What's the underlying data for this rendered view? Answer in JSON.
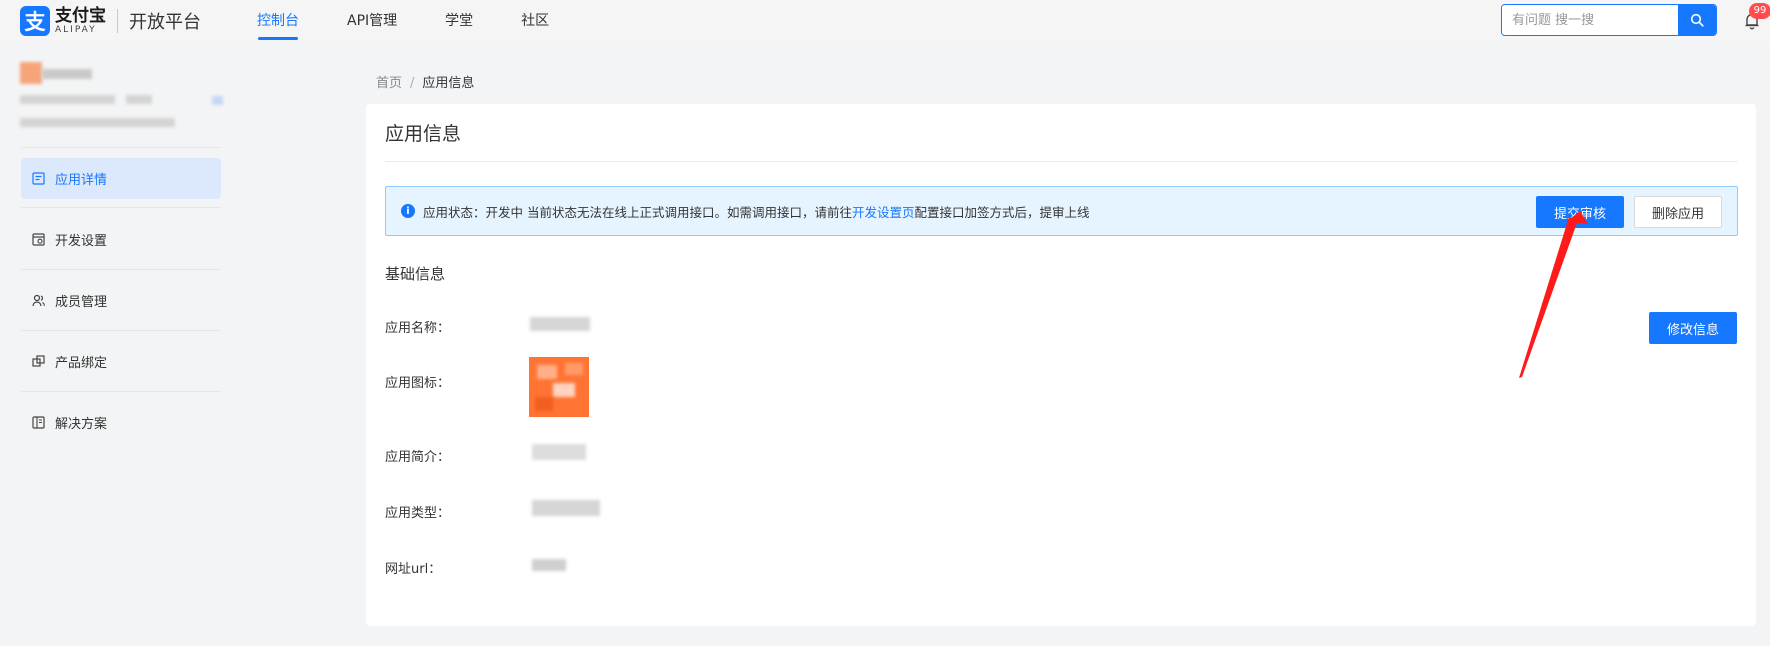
{
  "topbar": {
    "logo_mark": "支",
    "logo_cn": "支付宝",
    "logo_en": "ALIPAY",
    "platform_title": "开放平台",
    "nav": [
      {
        "label": "控制台",
        "active": true
      },
      {
        "label": "API管理",
        "active": false
      },
      {
        "label": "学堂",
        "active": false
      },
      {
        "label": "社区",
        "active": false
      }
    ],
    "search_placeholder": "有问题 搜一搜",
    "notification_count": "99"
  },
  "sidebar": {
    "menu": [
      {
        "label": "应用详情",
        "icon": "app-detail-icon",
        "active": true
      },
      {
        "label": "开发设置",
        "icon": "dev-settings-icon",
        "active": false
      },
      {
        "label": "成员管理",
        "icon": "members-icon",
        "active": false
      },
      {
        "label": "产品绑定",
        "icon": "product-binding-icon",
        "active": false
      },
      {
        "label": "解决方案",
        "icon": "solutions-icon",
        "active": false
      }
    ]
  },
  "breadcrumb": {
    "home": "首页",
    "separator": "/",
    "current": "应用信息"
  },
  "main": {
    "title": "应用信息",
    "alert": {
      "prefix": "应用状态：开发中 当前状态无法在线上正式调用接口。如需调用接口，请前往",
      "link": "开发设置页",
      "suffix": "配置接口加签方式后，提审上线",
      "submit_label": "提交审核",
      "delete_label": "删除应用"
    },
    "section_title": "基础信息",
    "edit_label": "修改信息",
    "fields": [
      {
        "label": "应用名称："
      },
      {
        "label": "应用图标："
      },
      {
        "label": "应用简介："
      },
      {
        "label": "应用类型："
      },
      {
        "label": "网址url："
      }
    ]
  },
  "colors": {
    "accent": "#1677ff",
    "alert_bg": "#e6f4ff",
    "badge": "#ff4d4f",
    "annotation_arrow": "#ff1a1a"
  }
}
